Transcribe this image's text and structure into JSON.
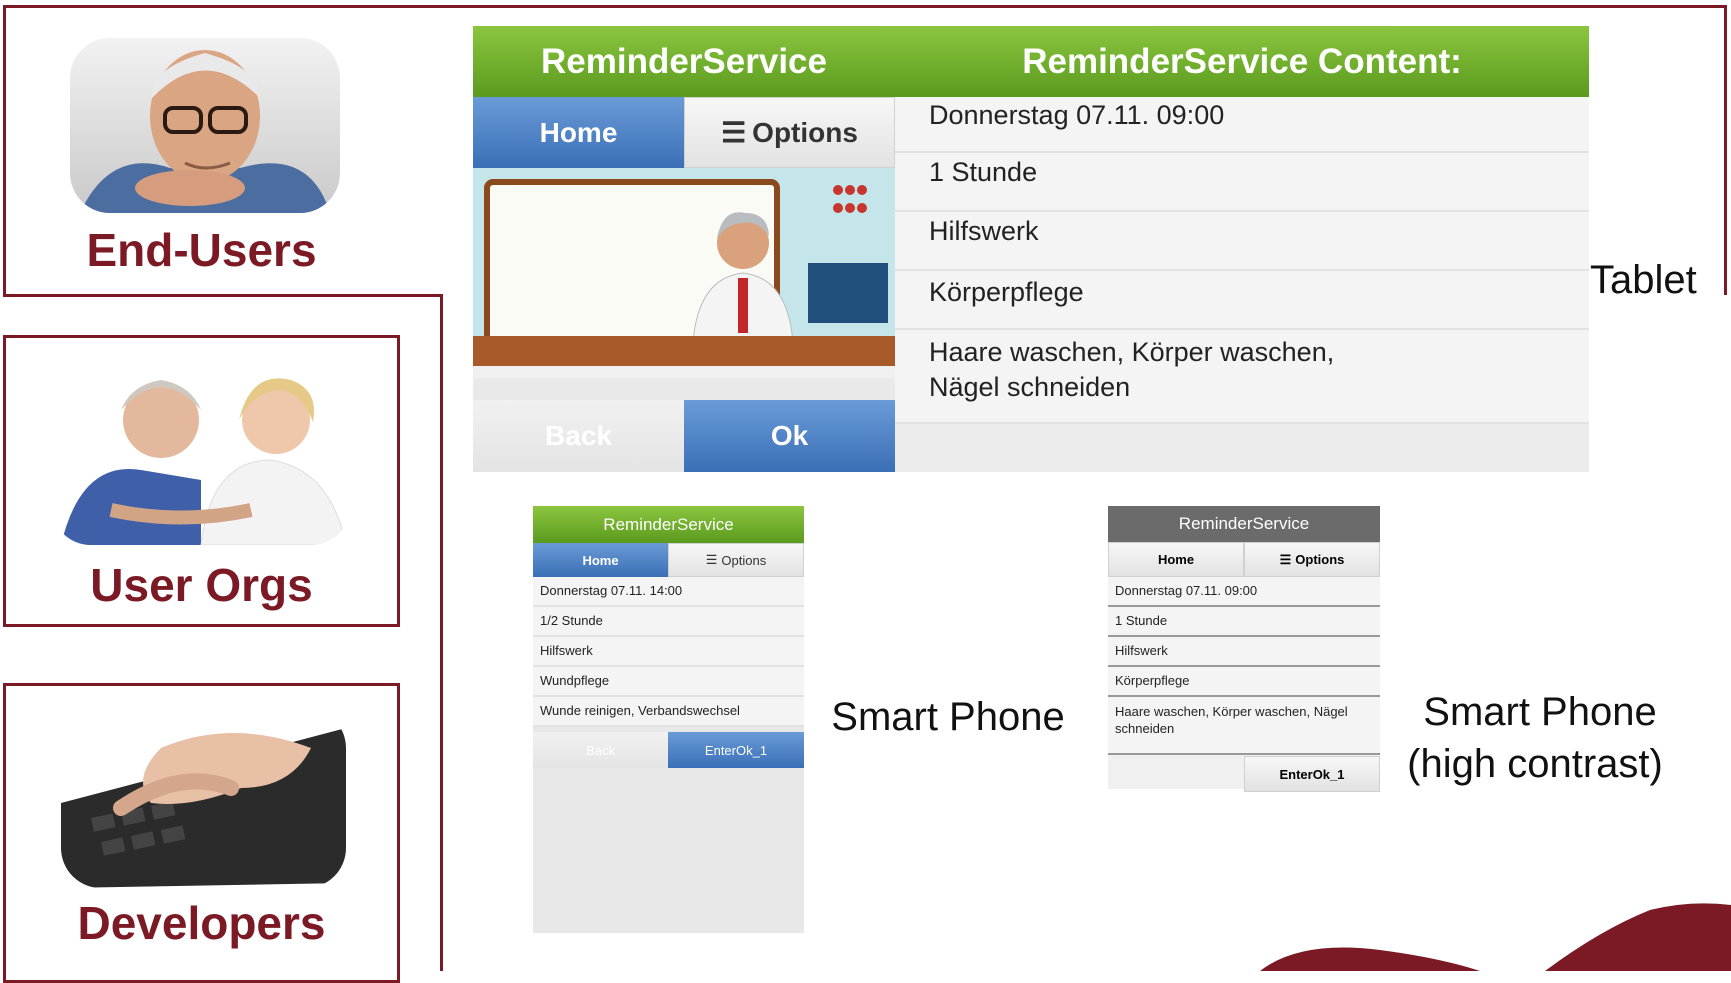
{
  "roles": {
    "end_users": "End-Users",
    "user_orgs": "User Orgs",
    "developers": "Developers"
  },
  "tablet": {
    "app_title": "ReminderService",
    "content_title": "ReminderService Content:",
    "home": "Home",
    "options": "Options",
    "back": "Back",
    "ok": "Ok",
    "rows": [
      "Donnerstag 07.11. 09:00",
      "1 Stunde",
      "Hilfswerk",
      "Körperpflege",
      "Haare waschen, Körper waschen, Nägel schneiden"
    ],
    "caption": "Tablet"
  },
  "phone": {
    "app_title": "ReminderService",
    "home": "Home",
    "options": "Options",
    "back": "Back",
    "enter": "EnterOk_1",
    "rows": [
      "Donnerstag 07.11. 14:00",
      "1/2 Stunde",
      "Hilfswerk",
      "Wundpflege",
      "Wunde reinigen, Verbandswechsel"
    ],
    "caption": "Smart Phone"
  },
  "phone_hc": {
    "app_title": "ReminderService",
    "home": "Home",
    "options": "Options",
    "enter": "EnterOk_1",
    "rows": [
      "Donnerstag 07.11. 09:00",
      "1 Stunde",
      "Hilfswerk",
      "Körperpflege",
      "Haare waschen, Körper waschen, Nägel schneiden"
    ],
    "caption_line1": "Smart Phone",
    "caption_line2": "(high contrast)"
  },
  "colors": {
    "wine": "#7b1a24",
    "green": "#6aab2a",
    "blue": "#3b6fb6",
    "hc_gray": "#6b6b6b"
  }
}
